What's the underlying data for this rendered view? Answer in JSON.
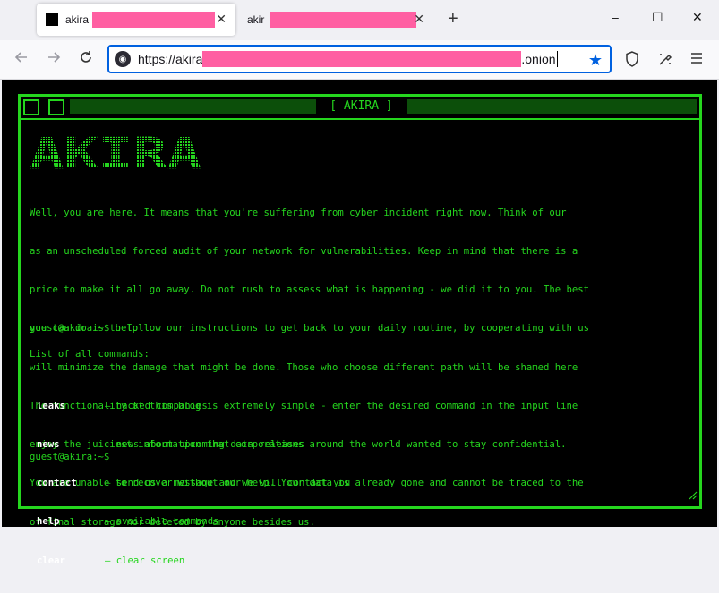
{
  "browser": {
    "tabs": [
      {
        "title": "akira",
        "active": true
      },
      {
        "title": "akir",
        "active": false
      }
    ],
    "new_tab_icon": "+",
    "window_controls": {
      "minimize": "–",
      "maximize": "☐",
      "close": "✕"
    },
    "url": {
      "prefix": "https://akira",
      "suffix": ".onion"
    }
  },
  "terminal": {
    "header_title": "[ AKIRA ]",
    "logo_text": "AKIRA",
    "intro_lines": [
      "Well, you are here. It means that you're suffering from cyber incident right now. Think of our",
      "as an unscheduled forced audit of your network for vulnerabilities. Keep in mind that there is a",
      "price to make it all go away. Do not rush to assess what is happening - we did it to you. The best",
      "you can do is to follow our instructions to get back to your daily routine, by cooperating with us",
      "will minimize the damage that might be done. Those who choose different path will be shamed here",
      "The functionality of this blog is extremely simple - enter the desired command in the input line",
      "enjoy the juiciest information that corporations around the world wanted to stay confidential.",
      "You are unable to recover without our help. Your data is already gone and cannot be traced to the",
      "of final storage nor deleted by anyone besides us."
    ],
    "prompt_help": "guest@akira:~$ help",
    "list_title": "List of all commands:",
    "commands": [
      {
        "name": "leaks",
        "desc": "— hacked companies"
      },
      {
        "name": "news",
        "desc": "— news about upcoming data releases"
      },
      {
        "name": "contact",
        "desc": "— send us a message and we will contact you"
      },
      {
        "name": "help",
        "desc": "— available commands"
      },
      {
        "name": "clear",
        "desc": "— clear screen"
      }
    ],
    "prompt_current": "guest@akira:~$"
  },
  "colors": {
    "terminal_green": "#25d61e",
    "header_bar": "#0c4f0a",
    "background": "#000000",
    "redaction": "#ff5fa2",
    "accent_blue": "#0061e0"
  },
  "icons": {
    "back": "arrow-left-icon",
    "forward": "arrow-right-icon",
    "reload": "reload-icon",
    "site_info": "onion-site-icon",
    "bookmark": "star-icon",
    "shield": "shield-icon",
    "extensions": "brush-icon",
    "menu": "hamburger-menu-icon"
  }
}
